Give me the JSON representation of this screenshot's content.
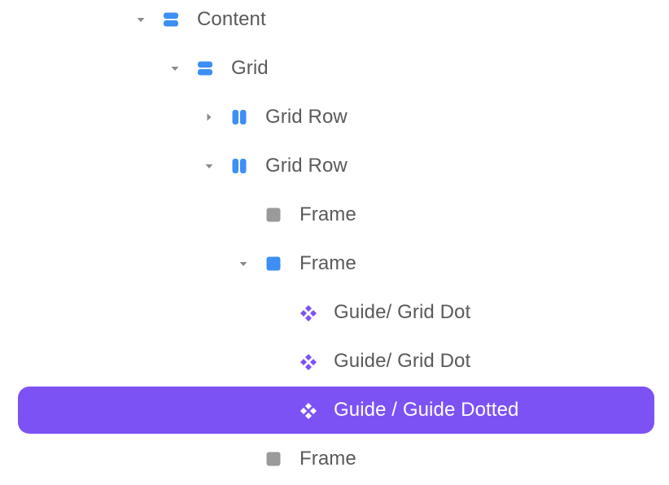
{
  "colors": {
    "layout_blue": "#3d8ff5",
    "frame_gray": "#9a9a9a",
    "component_purple": "#7d52f4",
    "text": "#5a5a5a",
    "selection_bg": "#7d52f4",
    "selection_text": "#ffffff"
  },
  "layers": [
    {
      "label": "Content",
      "icon": "vertical-stack-icon",
      "chevron": "expanded"
    },
    {
      "label": "Grid",
      "icon": "vertical-stack-icon",
      "chevron": "expanded"
    },
    {
      "label": "Grid Row",
      "icon": "horizontal-stack-icon",
      "chevron": "collapsed"
    },
    {
      "label": "Grid Row",
      "icon": "horizontal-stack-icon",
      "chevron": "expanded"
    },
    {
      "label": "Frame",
      "icon": "frame-icon-gray",
      "chevron": "none"
    },
    {
      "label": "Frame",
      "icon": "frame-icon-blue",
      "chevron": "expanded"
    },
    {
      "label": "Guide/ Grid Dot",
      "icon": "component-icon",
      "chevron": "none"
    },
    {
      "label": "Guide/ Grid Dot",
      "icon": "component-icon",
      "chevron": "none"
    },
    {
      "label": "Guide / Guide Dotted",
      "icon": "component-icon",
      "chevron": "none",
      "selected": true
    },
    {
      "label": "Frame",
      "icon": "frame-icon-gray",
      "chevron": "none"
    }
  ]
}
